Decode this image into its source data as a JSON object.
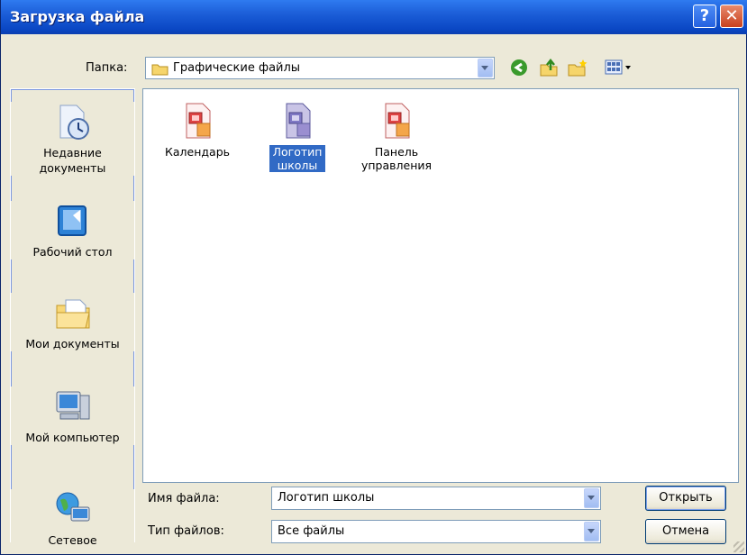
{
  "window": {
    "title": "Загрузка файла",
    "help_label": "?",
    "close_label": "✕"
  },
  "folder": {
    "label": "Папка:",
    "value": "Графические файлы"
  },
  "places": [
    {
      "label": "Недавние документы",
      "icon": "recent-documents-icon"
    },
    {
      "label": "Рабочий стол",
      "icon": "desktop-icon"
    },
    {
      "label": "Мои документы",
      "icon": "my-documents-icon"
    },
    {
      "label": "Мой компьютер",
      "icon": "my-computer-icon"
    },
    {
      "label": "Сетевое",
      "icon": "network-icon"
    }
  ],
  "files": [
    {
      "label": "Календарь",
      "selected": false
    },
    {
      "label": "Логотип школы",
      "selected": true
    },
    {
      "label": "Панель управления",
      "selected": false
    }
  ],
  "filename": {
    "label": "Имя файла:",
    "value": "Логотип школы"
  },
  "filetype": {
    "label": "Тип файлов:",
    "value": "Все файлы"
  },
  "buttons": {
    "open": "Открыть",
    "cancel": "Отмена"
  }
}
